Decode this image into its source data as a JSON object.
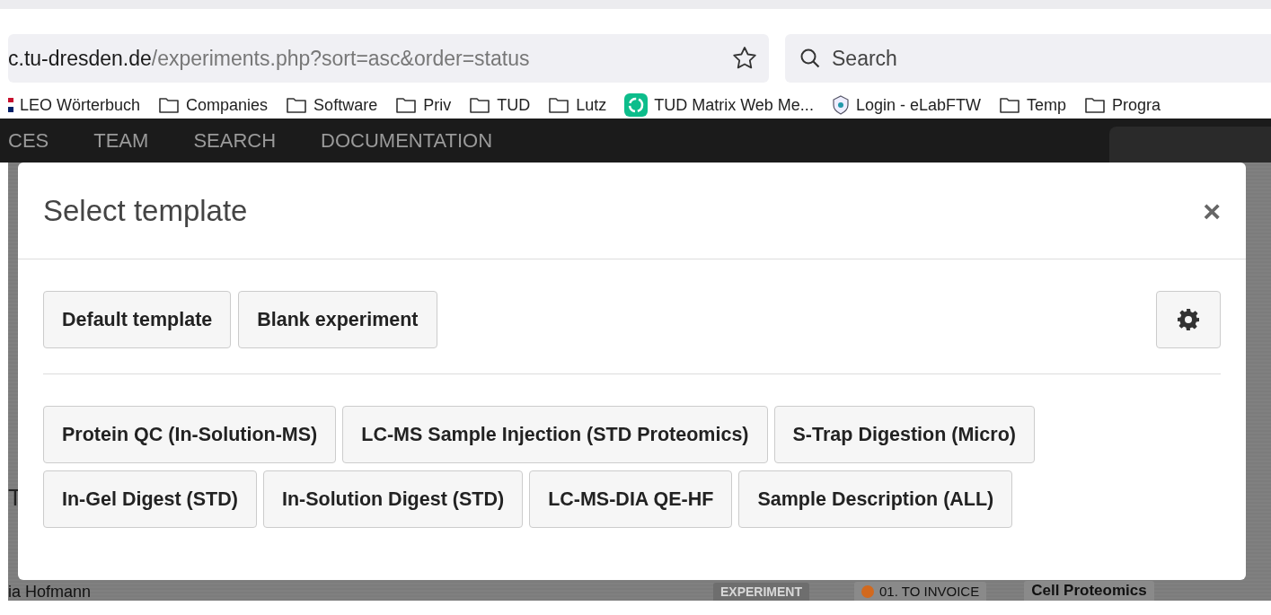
{
  "browser": {
    "url_host": "c.tu-dresden.de",
    "url_path": "/experiments.php?sort=asc&order=status",
    "search": {
      "placeholder": "Search"
    },
    "bookmarks": [
      {
        "label": "LEO Wörterbuch",
        "kind": "flag"
      },
      {
        "label": "Companies",
        "kind": "folder"
      },
      {
        "label": "Software",
        "kind": "folder"
      },
      {
        "label": "Priv",
        "kind": "folder"
      },
      {
        "label": "TUD",
        "kind": "folder"
      },
      {
        "label": "Lutz",
        "kind": "folder"
      },
      {
        "label": "TUD Matrix Web Me...",
        "kind": "matrix"
      },
      {
        "label": "Login - eLabFTW",
        "kind": "shield"
      },
      {
        "label": "Temp",
        "kind": "folder"
      },
      {
        "label": "Progra",
        "kind": "folder"
      }
    ]
  },
  "nav": {
    "items": [
      "CES",
      "TEAM",
      "SEARCH",
      "DOCUMENTATION"
    ]
  },
  "background": {
    "fragment": "T",
    "row": {
      "name": "ia Hofmann",
      "type": "EXPERIMENT",
      "status": {
        "label": "01. TO INVOICE",
        "color": "#d2691e"
      },
      "team": "Cell Proteomics"
    }
  },
  "modal": {
    "title": "Select template",
    "close": "×",
    "primary": [
      "Default template",
      "Blank experiment"
    ],
    "templates": [
      "Protein QC (In-Solution-MS)",
      "LC-MS Sample Injection (STD Proteomics)",
      "S-Trap Digestion (Micro)",
      "In-Gel Digest (STD)",
      "In-Solution Digest (STD)",
      "LC-MS-DIA QE-HF",
      "Sample Description (ALL)"
    ]
  }
}
